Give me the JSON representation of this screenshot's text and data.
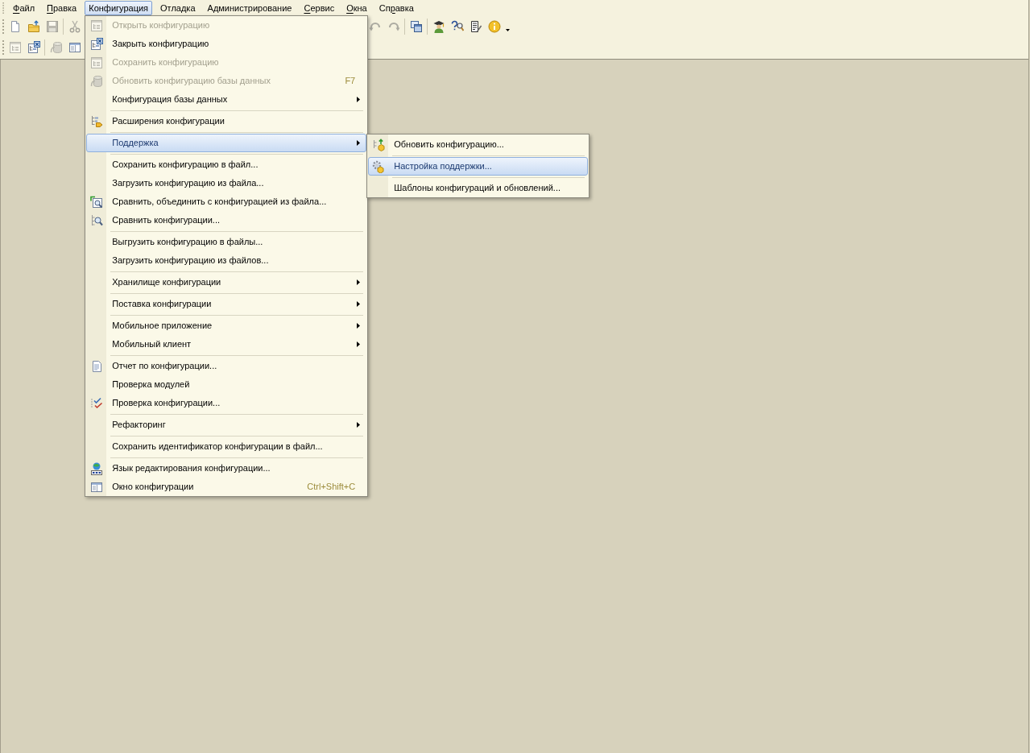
{
  "menu_bar": {
    "items": [
      {
        "mnemonic": "Ф",
        "after": "айл",
        "selected": false
      },
      {
        "mnemonic": "П",
        "after": "равка",
        "selected": false
      },
      {
        "label": "Конфигурация",
        "selected": true,
        "menu": [
          {
            "kind": "item",
            "label": "Открыть конфигурацию",
            "disabled": true,
            "selected": false,
            "has_submenu": false
          },
          {
            "kind": "item",
            "label": "Закрыть конфигурацию",
            "disabled": false,
            "selected": false,
            "has_submenu": false
          },
          {
            "kind": "item",
            "label": "Сохранить конфигурацию",
            "disabled": true,
            "selected": false,
            "has_submenu": false
          },
          {
            "kind": "item",
            "label": "Обновить конфигурацию базы данных",
            "shortcut": "F7",
            "disabled": true,
            "selected": false,
            "has_submenu": false
          },
          {
            "kind": "item",
            "label": "Конфигурация базы данных",
            "disabled": false,
            "selected": false,
            "has_submenu": true
          },
          {
            "kind": "separator"
          },
          {
            "kind": "item",
            "label": "Расширения конфигурации",
            "disabled": false,
            "selected": false,
            "has_submenu": false
          },
          {
            "kind": "separator"
          },
          {
            "kind": "item",
            "label": "Поддержка",
            "disabled": false,
            "selected": true,
            "has_submenu": true,
            "submenu": [
              {
                "kind": "item",
                "label": "Обновить конфигурацию...",
                "disabled": false,
                "selected": false,
                "has_submenu": false
              },
              {
                "kind": "separator"
              },
              {
                "kind": "item",
                "label": "Настройка поддержки...",
                "disabled": false,
                "selected": true,
                "has_submenu": false
              },
              {
                "kind": "separator"
              },
              {
                "kind": "item",
                "label": "Шаблоны конфигураций и обновлений...",
                "disabled": false,
                "selected": false,
                "has_submenu": false
              }
            ]
          },
          {
            "kind": "separator"
          },
          {
            "kind": "item",
            "label": "Сохранить конфигурацию в файл...",
            "disabled": false,
            "selected": false,
            "has_submenu": false
          },
          {
            "kind": "item",
            "label": "Загрузить конфигурацию из файла...",
            "disabled": false,
            "selected": false,
            "has_submenu": false
          },
          {
            "kind": "item",
            "label": "Сравнить, объединить с конфигурацией из файла...",
            "disabled": false,
            "selected": false,
            "has_submenu": false
          },
          {
            "kind": "item",
            "label": "Сравнить конфигурации...",
            "disabled": false,
            "selected": false,
            "has_submenu": false
          },
          {
            "kind": "separator"
          },
          {
            "kind": "item",
            "label": "Выгрузить конфигурацию в файлы...",
            "disabled": false,
            "selected": false,
            "has_submenu": false
          },
          {
            "kind": "item",
            "label": "Загрузить конфигурацию из файлов...",
            "disabled": false,
            "selected": false,
            "has_submenu": false
          },
          {
            "kind": "separator"
          },
          {
            "kind": "item",
            "label": "Хранилище конфигурации",
            "disabled": false,
            "selected": false,
            "has_submenu": true
          },
          {
            "kind": "separator"
          },
          {
            "kind": "item",
            "label": "Поставка конфигурации",
            "disabled": false,
            "selected": false,
            "has_submenu": true
          },
          {
            "kind": "separator"
          },
          {
            "kind": "item",
            "label": "Мобильное приложение",
            "disabled": false,
            "selected": false,
            "has_submenu": true
          },
          {
            "kind": "item",
            "label": "Мобильный клиент",
            "disabled": false,
            "selected": false,
            "has_submenu": true
          },
          {
            "kind": "separator"
          },
          {
            "kind": "item",
            "label": "Отчет по конфигурации...",
            "disabled": false,
            "selected": false,
            "has_submenu": false
          },
          {
            "kind": "item",
            "label": "Проверка модулей",
            "disabled": false,
            "selected": false,
            "has_submenu": false
          },
          {
            "kind": "item",
            "label": "Проверка конфигурации...",
            "disabled": false,
            "selected": false,
            "has_submenu": false
          },
          {
            "kind": "separator"
          },
          {
            "kind": "item",
            "label": "Рефакторинг",
            "disabled": false,
            "selected": false,
            "has_submenu": true
          },
          {
            "kind": "separator"
          },
          {
            "kind": "item",
            "label": "Сохранить идентификатор конфигурации в файл...",
            "disabled": false,
            "selected": false,
            "has_submenu": false
          },
          {
            "kind": "separator"
          },
          {
            "kind": "item",
            "label": "Язык редактирования конфигурации...",
            "disabled": false,
            "selected": false,
            "has_submenu": false
          },
          {
            "kind": "item",
            "label": "Окно конфигурации",
            "shortcut": "Ctrl+Shift+C",
            "disabled": false,
            "selected": false,
            "has_submenu": false
          }
        ]
      },
      {
        "label": "Отладка",
        "selected": false
      },
      {
        "label": "Администрирование",
        "selected": false
      },
      {
        "mnemonic": "С",
        "after": "ервис",
        "selected": false
      },
      {
        "mnemonic": "О",
        "after": "кна",
        "selected": false
      },
      {
        "before": "Сп",
        "mnemonic": "р",
        "after": "авка",
        "selected": false
      }
    ]
  },
  "toolbar_rows": [
    {
      "panels": [
        {
          "groups": [
            [
              {
                "disabled": false
              },
              {
                "disabled": false
              },
              {
                "disabled": true
              }
            ],
            [
              {
                "disabled": true
              }
            ]
          ]
        },
        {
          "groups": [
            [
              {
                "disabled": true
              },
              {
                "disabled": true
              }
            ],
            [
              {
                "disabled": false
              }
            ],
            [
              {
                "disabled": false
              },
              {
                "disabled": false
              },
              {
                "disabled": false
              },
              {
                "disabled": false
              },
              {
                "disabled": false
              }
            ]
          ]
        }
      ]
    },
    {
      "panels": [
        {
          "groups": [
            [
              {
                "disabled": true
              },
              {
                "disabled": false
              }
            ],
            [
              {
                "disabled": true
              },
              {
                "disabled": false
              }
            ]
          ]
        }
      ]
    }
  ]
}
